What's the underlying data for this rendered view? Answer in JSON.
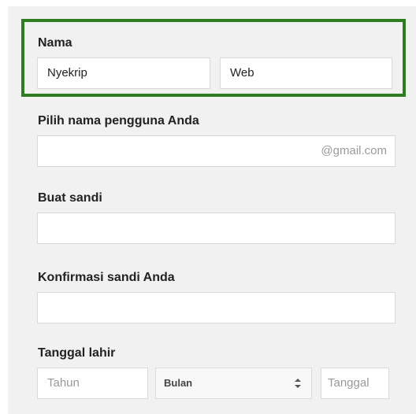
{
  "name_section": {
    "label": "Nama",
    "first_name_value": "Nyekrip",
    "last_name_value": "Web"
  },
  "username_section": {
    "label": "Pilih nama pengguna Anda",
    "value": "",
    "suffix": "@gmail.com"
  },
  "password_section": {
    "label": "Buat sandi",
    "value": ""
  },
  "confirm_password_section": {
    "label": "Konfirmasi sandi Anda",
    "value": ""
  },
  "birthdate_section": {
    "label": "Tanggal lahir",
    "year_placeholder": "Tahun",
    "month_selected": "Bulan",
    "day_placeholder": "Tanggal"
  },
  "colors": {
    "highlight_border": "#2e7d1f",
    "panel_background": "#f1f1f1"
  }
}
